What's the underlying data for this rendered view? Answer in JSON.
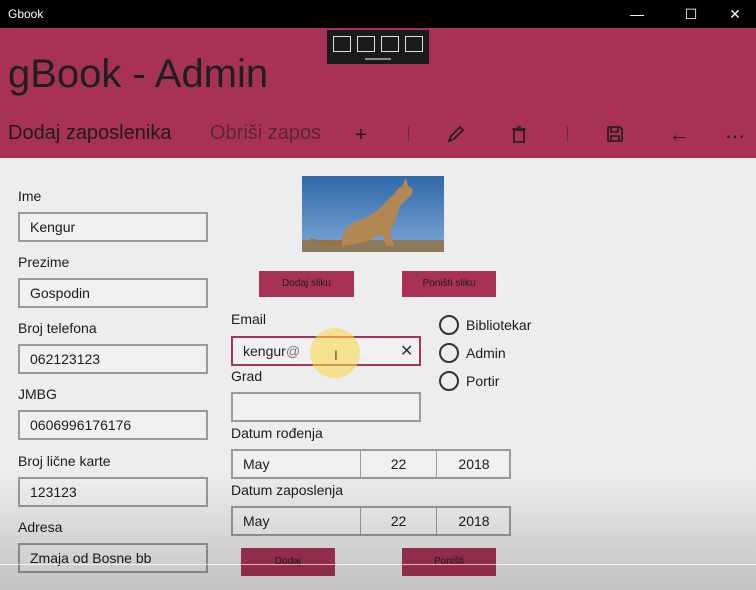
{
  "window": {
    "title": "Gbook"
  },
  "app": {
    "title": "gBook - Admin"
  },
  "commandbar": {
    "primary": "Dodaj zaposlenika",
    "secondary": "Obriši zapos",
    "icons": [
      "plus-icon",
      "pencil-icon",
      "trash-icon",
      "save-icon",
      "back-arrow-icon",
      "more-icon"
    ]
  },
  "form": {
    "ime": {
      "label": "Ime",
      "value": "Kengur"
    },
    "prezime": {
      "label": "Prezime",
      "value": "Gospodin"
    },
    "telefon": {
      "label": "Broj telefona",
      "value": "062123123"
    },
    "jmbg": {
      "label": "JMBG",
      "value": "0606996176176"
    },
    "licna": {
      "label": "Broj lične karte",
      "value": "123123"
    },
    "adresa": {
      "label": "Adresa",
      "value": "Zmaja od Bosne bb"
    },
    "email": {
      "label": "Email",
      "value": "kengur",
      "suggestion": "@"
    },
    "grad": {
      "label": "Grad",
      "value": ""
    },
    "datum_rodjenja": {
      "label": "Datum rođenja",
      "month": "May",
      "day": "22",
      "year": "2018"
    },
    "datum_zaposlenja": {
      "label": "Datum zaposlenja",
      "month": "May",
      "day": "22",
      "year": "2018"
    }
  },
  "photo_buttons": {
    "add": "Dodaj sliku",
    "reset": "Poništi sliku"
  },
  "roles": [
    "Bibliotekar",
    "Admin",
    "Portir"
  ],
  "actions": {
    "add": "Dodaj",
    "cancel": "Poništi"
  },
  "colors": {
    "accent": "#a83256",
    "background": "#ededf0"
  }
}
